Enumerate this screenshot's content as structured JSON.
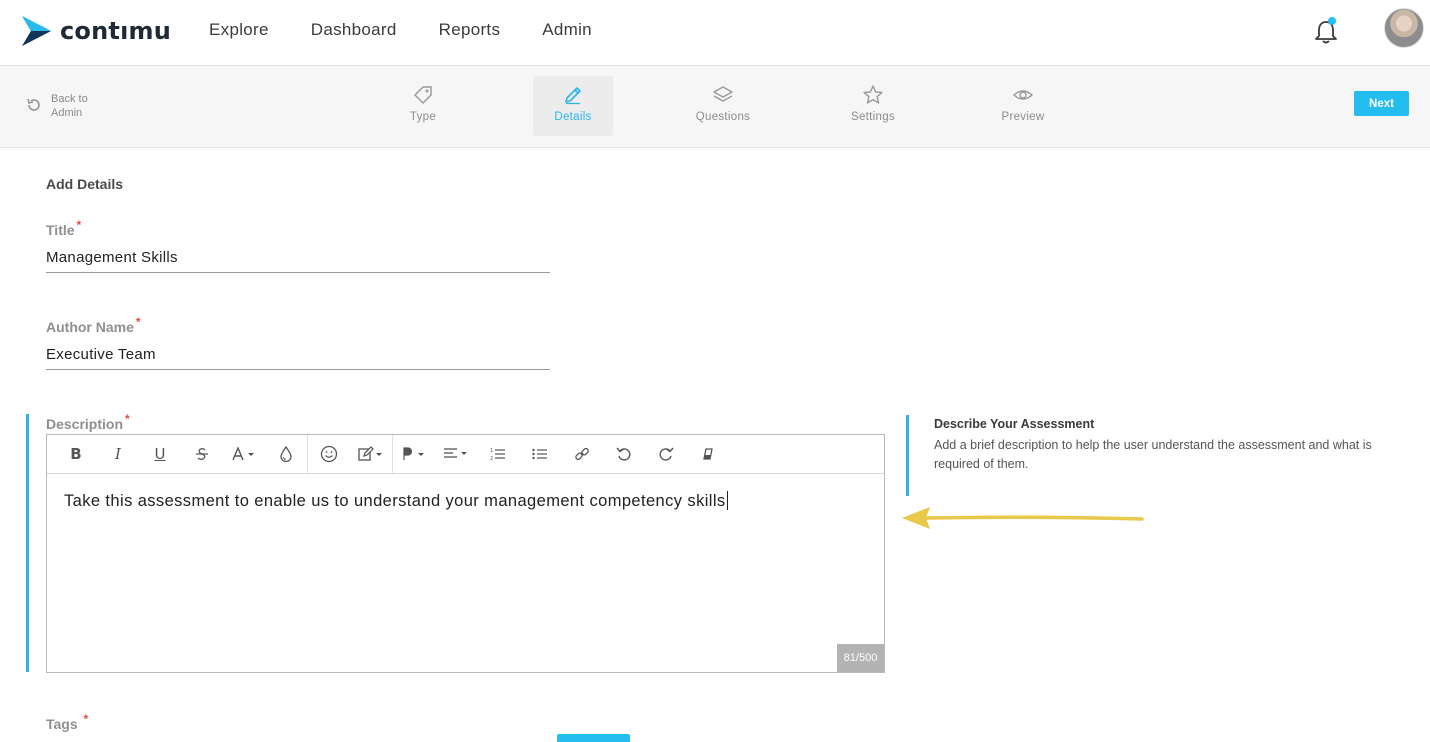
{
  "brand": {
    "name": "contıнu",
    "accent": "#23bdf0"
  },
  "nav": {
    "items": [
      "Explore",
      "Dashboard",
      "Reports",
      "Admin"
    ]
  },
  "header": {
    "notification_icon": "bell-icon",
    "avatar": "user-avatar"
  },
  "stepper": {
    "back_label": "Back to Admin",
    "steps": [
      {
        "label": "Type",
        "icon": "tag-icon",
        "active": false
      },
      {
        "label": "Details",
        "icon": "pencil-icon",
        "active": true
      },
      {
        "label": "Questions",
        "icon": "layers-icon",
        "active": false
      },
      {
        "label": "Settings",
        "icon": "star-icon",
        "active": false
      },
      {
        "label": "Preview",
        "icon": "eye-icon",
        "active": false
      }
    ],
    "next_label": "Next"
  },
  "form": {
    "section_title": "Add Details",
    "title_label": "Title",
    "title_value": "Management Skills",
    "author_label": "Author Name",
    "author_value": "Executive Team",
    "description_label": "Description",
    "description_value": "Take this assessment to enable us to understand your management competency skills",
    "char_count": "81/500",
    "tags_label": "Tags",
    "required_mark": "*"
  },
  "help": {
    "title": "Describe Your Assessment",
    "text": "Add a brief description to help the user understand the assessment and what is required of them."
  },
  "colors": {
    "active_step": "#2ab6e8",
    "required": "#e74c3c",
    "arrow": "#e8c94a"
  }
}
